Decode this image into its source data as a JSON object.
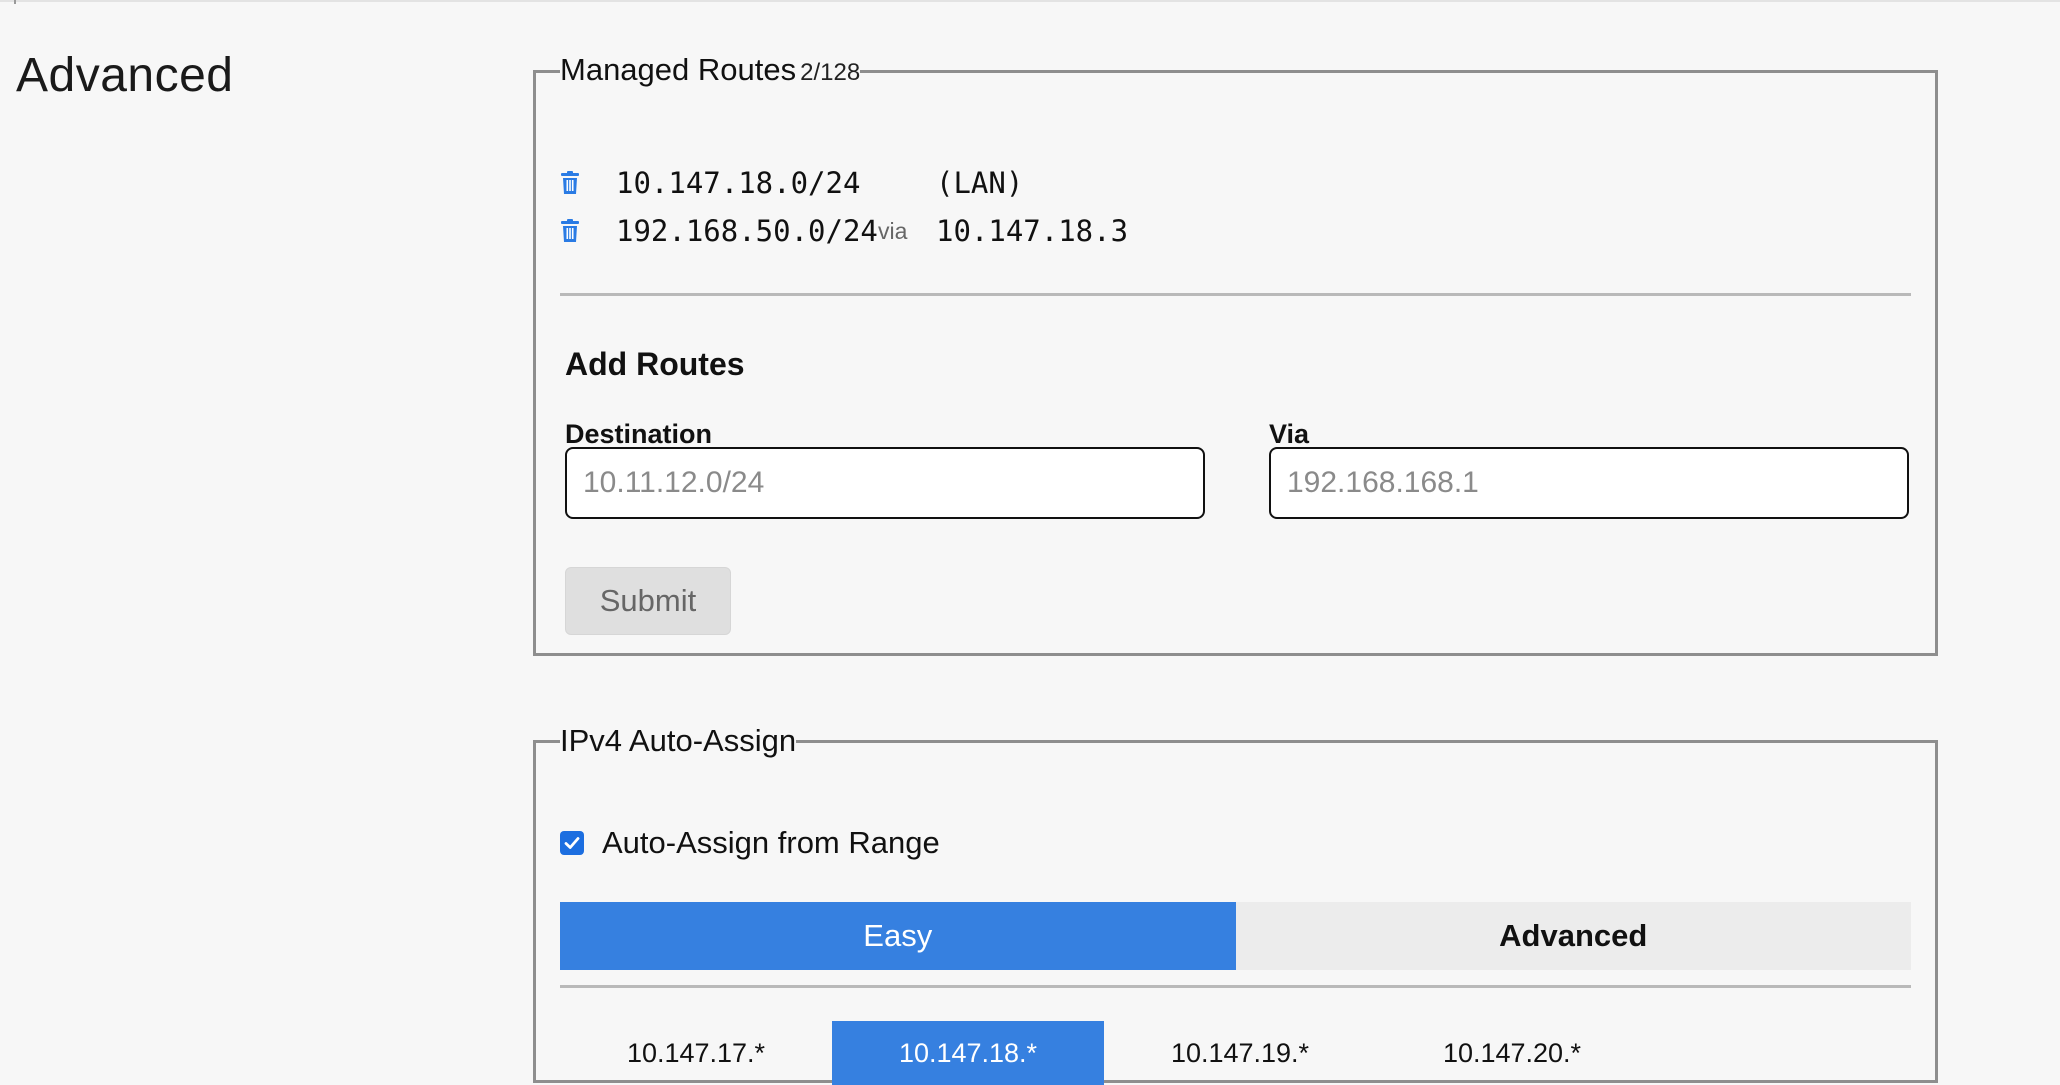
{
  "section": {
    "title": "Advanced"
  },
  "managed_routes": {
    "legend": "Managed Routes",
    "count": "2/128",
    "routes": [
      {
        "destination": "10.147.18.0/24",
        "via_word": "",
        "target": "(LAN)"
      },
      {
        "destination": "192.168.50.0/24",
        "via_word": "via",
        "target": "10.147.18.3"
      }
    ],
    "add_title": "Add Routes",
    "destination_label": "Destination",
    "destination_placeholder": "10.11.12.0/24",
    "destination_value": "",
    "via_label": "Via",
    "via_placeholder": "192.168.168.1",
    "via_value": "",
    "submit_label": "Submit"
  },
  "ipv4": {
    "legend": "IPv4 Auto-Assign",
    "auto_assign_label": "Auto-Assign from Range",
    "auto_assign_checked": true,
    "mode_tabs": [
      "Easy",
      "Advanced"
    ],
    "active_mode": "Easy",
    "subnets": [
      "10.147.17.*",
      "10.147.18.*",
      "10.147.19.*",
      "10.147.20.*"
    ],
    "selected_subnet": "10.147.18.*"
  },
  "colors": {
    "accent": "#3680e0",
    "trash_icon": "#2a7be4",
    "checkbox": "#1c6ee0"
  },
  "icons": {
    "route_delete": "trash-icon",
    "checkbox_check": "check-icon"
  }
}
